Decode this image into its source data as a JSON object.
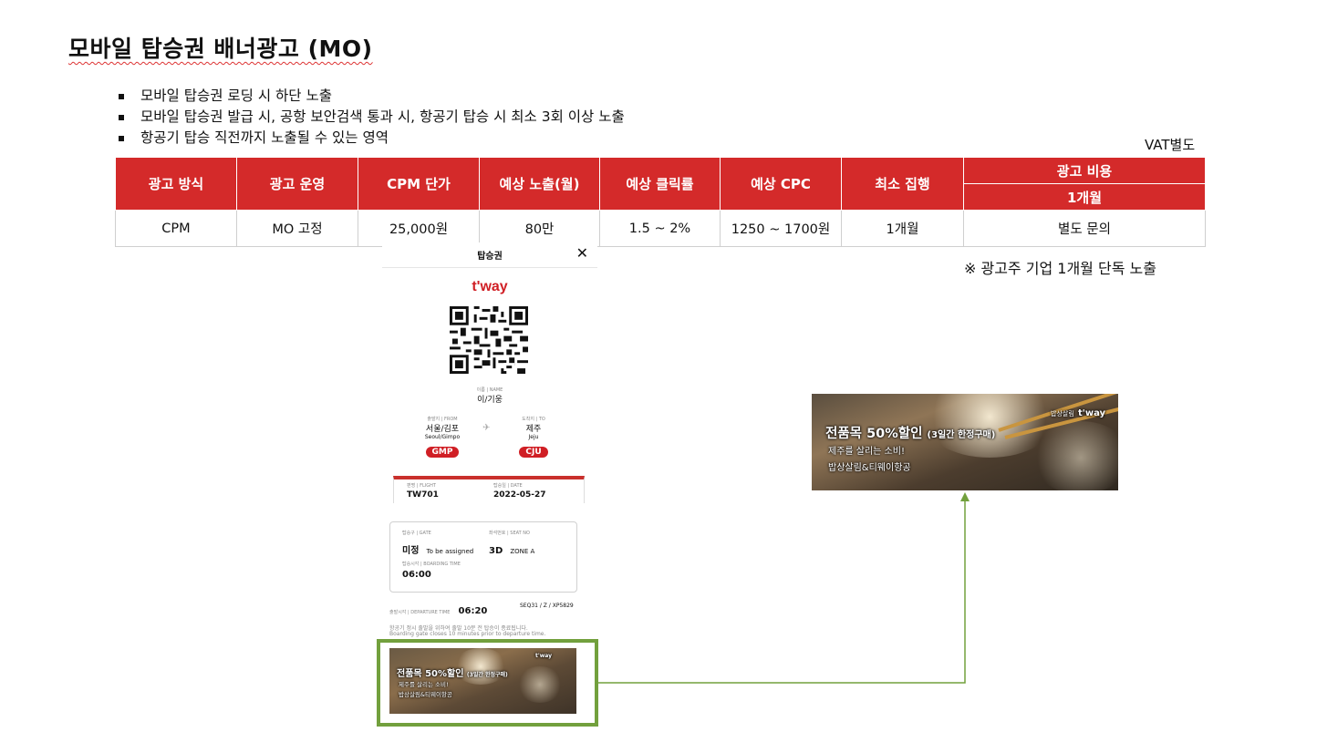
{
  "title": "모바일 탑승권 배너광고 (MO)",
  "bullets": [
    "모바일 탑승권  로딩 시 하단 노출",
    "모바일 탑승권 발급 시, 공항 보안검색 통과 시, 항공기 탑승 시 최소 3회 이상 노출",
    "항공기 탑승 직전까지 노출될 수 있는 영역"
  ],
  "vat_note": "VAT별도",
  "table": {
    "headers": [
      "광고 방식",
      "광고 운영",
      "CPM 단가",
      "예상 노출(월)",
      "예상 클릭률",
      "예상 CPC",
      "최소 집행",
      "광고 비용"
    ],
    "subheader": "1개월",
    "row": [
      "CPM",
      "MO 고정",
      "25,000원",
      "80만",
      "1.5 ~ 2%",
      "1250 ~ 1700원",
      "1개월",
      "별도 문의"
    ]
  },
  "exclusive_note": "※ 광고주 기업 1개월 단독 노출",
  "phone": {
    "header_title": "탑승권",
    "close_glyph": "✕",
    "logo": "t'way",
    "name_label": "이름 | NAME",
    "name_value": "이/기웅",
    "from_label": "출발지 | FROM",
    "from_city": "서울/김포",
    "from_city_en": "Seoul/Gimpo",
    "from_code": "GMP",
    "to_label": "도착지 | TO",
    "to_city": "제주",
    "to_city_en": "Jeju",
    "to_code": "CJU",
    "flight_label": "편명 | FLIGHT",
    "flight_value": "TW701",
    "date_label": "탑승일 | DATE",
    "date_value": "2022-05-27",
    "gate_label": "탑승구 | GATE",
    "gate_value": "미정",
    "gate_note": "To be assigned",
    "seat_label": "좌석번호 | SEAT NO",
    "seat_value": "3D",
    "seat_zone": "ZONE A",
    "boarding_label": "탑승시각 | BOARDING TIME",
    "boarding_value": "06:00",
    "departure_label": "출발시각 | DEPARTURE TIME",
    "departure_value": "06:20",
    "seq": "SEQ31 / Z / XP5829",
    "notice_ko": "항공기 정시 출발을 위하여 출발 10분 전 탑승이 종료됩니다.",
    "notice_en": "Boarding gate closes 10 minutes prior to departure time."
  },
  "banner": {
    "headline": "전품목 50%할인",
    "headline_sub": "(3일간 한정구매)",
    "line2": "제주를 살리는 소비!",
    "line3": "밥상살림&티웨이항공",
    "brand_small": "밥상살림",
    "brand_logo": "t'way"
  },
  "colors": {
    "table_header": "#d42a2a",
    "brand_red": "#d01f25",
    "highlight_green": "#72a03d"
  }
}
